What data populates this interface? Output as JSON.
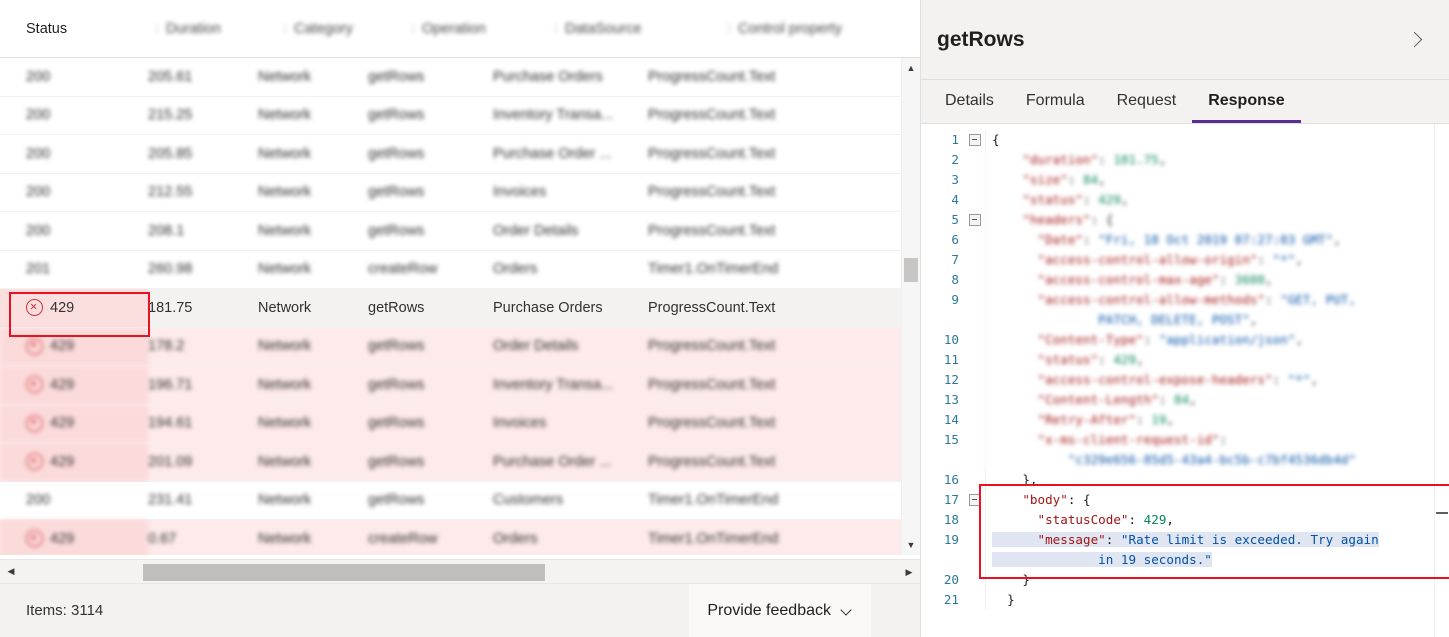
{
  "table": {
    "columns": [
      {
        "label": "Status",
        "sharp": true
      },
      {
        "label": "Duration",
        "sharp": false
      },
      {
        "label": "Category",
        "sharp": false
      },
      {
        "label": "Operation",
        "sharp": false
      },
      {
        "label": "DataSource",
        "sharp": false
      },
      {
        "label": "Control property",
        "sharp": false
      }
    ],
    "rows": [
      {
        "status": "200",
        "duration": "205.61",
        "category": "Network",
        "operation": "getRows",
        "datasource": "Purchase Orders",
        "control": "ProgressCount.Text",
        "error": false,
        "selected": false,
        "sharp": false
      },
      {
        "status": "200",
        "duration": "215.25",
        "category": "Network",
        "operation": "getRows",
        "datasource": "Inventory Transa...",
        "control": "ProgressCount.Text",
        "error": false,
        "selected": false,
        "sharp": false
      },
      {
        "status": "200",
        "duration": "205.85",
        "category": "Network",
        "operation": "getRows",
        "datasource": "Purchase Order ...",
        "control": "ProgressCount.Text",
        "error": false,
        "selected": false,
        "sharp": false
      },
      {
        "status": "200",
        "duration": "212.55",
        "category": "Network",
        "operation": "getRows",
        "datasource": "Invoices",
        "control": "ProgressCount.Text",
        "error": false,
        "selected": false,
        "sharp": false
      },
      {
        "status": "200",
        "duration": "208.1",
        "category": "Network",
        "operation": "getRows",
        "datasource": "Order Details",
        "control": "ProgressCount.Text",
        "error": false,
        "selected": false,
        "sharp": false
      },
      {
        "status": "201",
        "duration": "260.98",
        "category": "Network",
        "operation": "createRow",
        "datasource": "Orders",
        "control": "Timer1.OnTimerEnd",
        "error": false,
        "selected": false,
        "sharp": false
      },
      {
        "status": "429",
        "duration": "181.75",
        "category": "Network",
        "operation": "getRows",
        "datasource": "Purchase Orders",
        "control": "ProgressCount.Text",
        "error": true,
        "selected": true,
        "sharp": true
      },
      {
        "status": "429",
        "duration": "178.2",
        "category": "Network",
        "operation": "getRows",
        "datasource": "Order Details",
        "control": "ProgressCount.Text",
        "error": true,
        "selected": false,
        "sharp": false
      },
      {
        "status": "429",
        "duration": "196.71",
        "category": "Network",
        "operation": "getRows",
        "datasource": "Inventory Transa...",
        "control": "ProgressCount.Text",
        "error": true,
        "selected": false,
        "sharp": false
      },
      {
        "status": "429",
        "duration": "194.61",
        "category": "Network",
        "operation": "getRows",
        "datasource": "Invoices",
        "control": "ProgressCount.Text",
        "error": true,
        "selected": false,
        "sharp": false
      },
      {
        "status": "429",
        "duration": "201.09",
        "category": "Network",
        "operation": "getRows",
        "datasource": "Purchase Order ...",
        "control": "ProgressCount.Text",
        "error": true,
        "selected": false,
        "sharp": false
      },
      {
        "status": "200",
        "duration": "231.41",
        "category": "Network",
        "operation": "getRows",
        "datasource": "Customers",
        "control": "Timer1.OnTimerEnd",
        "error": false,
        "selected": false,
        "sharp": false
      },
      {
        "status": "429",
        "duration": "0.67",
        "category": "Network",
        "operation": "createRow",
        "datasource": "Orders",
        "control": "Timer1.OnTimerEnd",
        "error": true,
        "selected": false,
        "sharp": false
      }
    ]
  },
  "footer": {
    "items_label": "Items: 3114",
    "feedback_label": "Provide feedback"
  },
  "panel": {
    "title": "getRows",
    "collapse_icon": "chevron-right-icon",
    "tabs": [
      {
        "label": "Details",
        "active": false
      },
      {
        "label": "Formula",
        "active": false
      },
      {
        "label": "Request",
        "active": false
      },
      {
        "label": "Response",
        "active": true
      }
    ],
    "accent_color": "#5c2d91"
  },
  "response_json": {
    "lines": [
      {
        "num": "1",
        "fold": true,
        "blur": false,
        "parts": [
          {
            "t": "{",
            "c": "p"
          }
        ]
      },
      {
        "num": "2",
        "fold": false,
        "blur": true,
        "parts": [
          {
            "t": "    \"duration\"",
            "c": "k"
          },
          {
            "t": ": ",
            "c": "p"
          },
          {
            "t": "181.75",
            "c": "n"
          },
          {
            "t": ",",
            "c": "p"
          }
        ]
      },
      {
        "num": "3",
        "fold": false,
        "blur": true,
        "parts": [
          {
            "t": "    \"size\"",
            "c": "k"
          },
          {
            "t": ": ",
            "c": "p"
          },
          {
            "t": "84",
            "c": "n"
          },
          {
            "t": ",",
            "c": "p"
          }
        ]
      },
      {
        "num": "4",
        "fold": false,
        "blur": true,
        "parts": [
          {
            "t": "    \"status\"",
            "c": "k"
          },
          {
            "t": ": ",
            "c": "p"
          },
          {
            "t": "429",
            "c": "n"
          },
          {
            "t": ",",
            "c": "p"
          }
        ]
      },
      {
        "num": "5",
        "fold": true,
        "blur": true,
        "parts": [
          {
            "t": "    \"headers\"",
            "c": "k"
          },
          {
            "t": ": {",
            "c": "p"
          }
        ]
      },
      {
        "num": "6",
        "fold": false,
        "blur": true,
        "parts": [
          {
            "t": "      \"Date\"",
            "c": "k"
          },
          {
            "t": ": ",
            "c": "p"
          },
          {
            "t": "\"Fri, 18 Oct 2019 07:27:03 GMT\"",
            "c": "s"
          },
          {
            "t": ",",
            "c": "p"
          }
        ]
      },
      {
        "num": "7",
        "fold": false,
        "blur": true,
        "parts": [
          {
            "t": "      \"access-control-allow-origin\"",
            "c": "k"
          },
          {
            "t": ": ",
            "c": "p"
          },
          {
            "t": "\"*\"",
            "c": "s"
          },
          {
            "t": ",",
            "c": "p"
          }
        ]
      },
      {
        "num": "8",
        "fold": false,
        "blur": true,
        "parts": [
          {
            "t": "      \"access-control-max-age\"",
            "c": "k"
          },
          {
            "t": ": ",
            "c": "p"
          },
          {
            "t": "3600",
            "c": "n"
          },
          {
            "t": ",",
            "c": "p"
          }
        ]
      },
      {
        "num": "9",
        "fold": false,
        "blur": true,
        "parts": [
          {
            "t": "      \"access-control-allow-methods\"",
            "c": "k"
          },
          {
            "t": ": ",
            "c": "p"
          },
          {
            "t": "\"GET, PUT,",
            "c": "s"
          }
        ]
      },
      {
        "num": "",
        "fold": false,
        "blur": true,
        "parts": [
          {
            "t": "              PATCH, DELETE, POST\"",
            "c": "s"
          },
          {
            "t": ",",
            "c": "p"
          }
        ]
      },
      {
        "num": "10",
        "fold": false,
        "blur": true,
        "parts": [
          {
            "t": "      \"Content-Type\"",
            "c": "k"
          },
          {
            "t": ": ",
            "c": "p"
          },
          {
            "t": "\"application/json\"",
            "c": "s"
          },
          {
            "t": ",",
            "c": "p"
          }
        ]
      },
      {
        "num": "11",
        "fold": false,
        "blur": true,
        "parts": [
          {
            "t": "      \"status\"",
            "c": "k"
          },
          {
            "t": ": ",
            "c": "p"
          },
          {
            "t": "429",
            "c": "n"
          },
          {
            "t": ",",
            "c": "p"
          }
        ]
      },
      {
        "num": "12",
        "fold": false,
        "blur": true,
        "parts": [
          {
            "t": "      \"access-control-expose-headers\"",
            "c": "k"
          },
          {
            "t": ": ",
            "c": "p"
          },
          {
            "t": "\"*\"",
            "c": "s"
          },
          {
            "t": ",",
            "c": "p"
          }
        ]
      },
      {
        "num": "13",
        "fold": false,
        "blur": true,
        "parts": [
          {
            "t": "      \"Content-Length\"",
            "c": "k"
          },
          {
            "t": ": ",
            "c": "p"
          },
          {
            "t": "84",
            "c": "n"
          },
          {
            "t": ",",
            "c": "p"
          }
        ]
      },
      {
        "num": "14",
        "fold": false,
        "blur": true,
        "parts": [
          {
            "t": "      \"Retry-After\"",
            "c": "k"
          },
          {
            "t": ": ",
            "c": "p"
          },
          {
            "t": "19",
            "c": "n"
          },
          {
            "t": ",",
            "c": "p"
          }
        ]
      },
      {
        "num": "15",
        "fold": false,
        "blur": true,
        "parts": [
          {
            "t": "      \"x-ms-client-request-id\"",
            "c": "k"
          },
          {
            "t": ":",
            "c": "p"
          }
        ]
      },
      {
        "num": "",
        "fold": false,
        "blur": true,
        "parts": [
          {
            "t": "          \"c329e656-85d5-43a4-bc5b-c7bf4536db4d\"",
            "c": "s"
          }
        ]
      },
      {
        "num": "16",
        "fold": false,
        "blur": false,
        "parts": [
          {
            "t": "    },",
            "c": "p"
          }
        ]
      },
      {
        "num": "17",
        "fold": true,
        "blur": false,
        "parts": [
          {
            "t": "    \"body\"",
            "c": "k"
          },
          {
            "t": ": {",
            "c": "p"
          }
        ]
      },
      {
        "num": "18",
        "fold": false,
        "blur": false,
        "parts": [
          {
            "t": "      \"statusCode\"",
            "c": "k"
          },
          {
            "t": ": ",
            "c": "p"
          },
          {
            "t": "429",
            "c": "n"
          },
          {
            "t": ",",
            "c": "p"
          }
        ]
      },
      {
        "num": "19",
        "fold": false,
        "blur": false,
        "hl": true,
        "parts": [
          {
            "t": "      \"message\"",
            "c": "k"
          },
          {
            "t": ": ",
            "c": "p"
          },
          {
            "t": "\"Rate limit is exceeded. Try again",
            "c": "s"
          }
        ]
      },
      {
        "num": "",
        "fold": false,
        "blur": false,
        "hl": true,
        "parts": [
          {
            "t": "              in 19 seconds.\"",
            "c": "s"
          }
        ]
      },
      {
        "num": "20",
        "fold": false,
        "blur": false,
        "parts": [
          {
            "t": "    }",
            "c": "p"
          }
        ]
      },
      {
        "num": "21",
        "fold": false,
        "blur": false,
        "parts": [
          {
            "t": "  }",
            "c": "p"
          }
        ]
      }
    ]
  },
  "annotations": {
    "status_cell_outline_color": "#e81123",
    "body_outline_color": "#e81123"
  }
}
